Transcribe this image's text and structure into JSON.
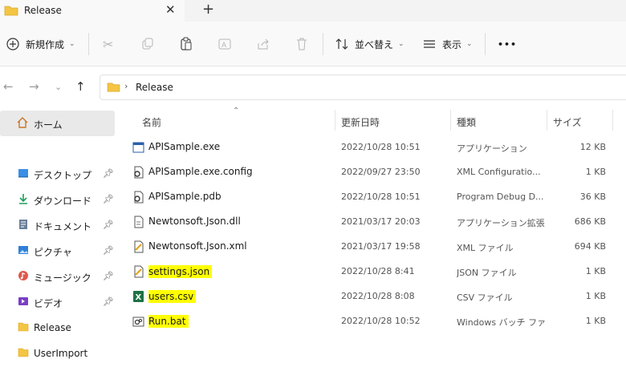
{
  "tab": {
    "title": "Release",
    "close": "✕",
    "new_tab": "+"
  },
  "toolbar": {
    "new_label": "新規作成",
    "sort_label": "並べ替え",
    "view_label": "表示",
    "more": "•••"
  },
  "address": {
    "crumb": "Release",
    "separator": "›"
  },
  "sidebar": {
    "home": "ホーム",
    "items": [
      {
        "label": "デスクトップ",
        "icon": "desktop-icon",
        "pinned": true
      },
      {
        "label": "ダウンロード",
        "icon": "download-icon",
        "pinned": true
      },
      {
        "label": "ドキュメント",
        "icon": "documents-icon",
        "pinned": true
      },
      {
        "label": "ピクチャ",
        "icon": "pictures-icon",
        "pinned": true
      },
      {
        "label": "ミュージック",
        "icon": "music-icon",
        "pinned": true
      },
      {
        "label": "ビデオ",
        "icon": "videos-icon",
        "pinned": true
      },
      {
        "label": "Release",
        "icon": "folder-icon",
        "pinned": false
      },
      {
        "label": "UserImport",
        "icon": "folder-icon",
        "pinned": false
      }
    ]
  },
  "columns": {
    "name": "名前",
    "modified": "更新日時",
    "type": "種類",
    "size": "サイズ"
  },
  "files": [
    {
      "name": "APISample.exe",
      "modified": "2022/10/28 10:51",
      "type": "アプリケーション",
      "size": "12 KB",
      "icon": "exe-icon",
      "highlight": false
    },
    {
      "name": "APISample.exe.config",
      "modified": "2022/09/27 23:50",
      "type": "XML Configuratio...",
      "size": "1 KB",
      "icon": "config-icon",
      "highlight": false
    },
    {
      "name": "APISample.pdb",
      "modified": "2022/10/28 10:51",
      "type": "Program Debug D...",
      "size": "36 KB",
      "icon": "pdb-icon",
      "highlight": false
    },
    {
      "name": "Newtonsoft.Json.dll",
      "modified": "2021/03/17 20:03",
      "type": "アプリケーション拡張",
      "size": "686 KB",
      "icon": "dll-icon",
      "highlight": false
    },
    {
      "name": "Newtonsoft.Json.xml",
      "modified": "2021/03/17 19:58",
      "type": "XML ファイル",
      "size": "694 KB",
      "icon": "xml-icon",
      "highlight": false
    },
    {
      "name": "settings.json",
      "modified": "2022/10/28 8:41",
      "type": "JSON ファイル",
      "size": "1 KB",
      "icon": "json-icon",
      "highlight": true
    },
    {
      "name": "users.csv",
      "modified": "2022/10/28 8:08",
      "type": "CSV ファイル",
      "size": "1 KB",
      "icon": "excel-csv-icon",
      "highlight": true
    },
    {
      "name": "Run.bat",
      "modified": "2022/10/28 10:52",
      "type": "Windows バッチ ファ...",
      "size": "1 KB",
      "icon": "bat-icon",
      "highlight": true
    }
  ],
  "colors": {
    "highlight": "#ffff00",
    "folder": "#f4c542",
    "selected_bg": "#e9e9e9"
  }
}
